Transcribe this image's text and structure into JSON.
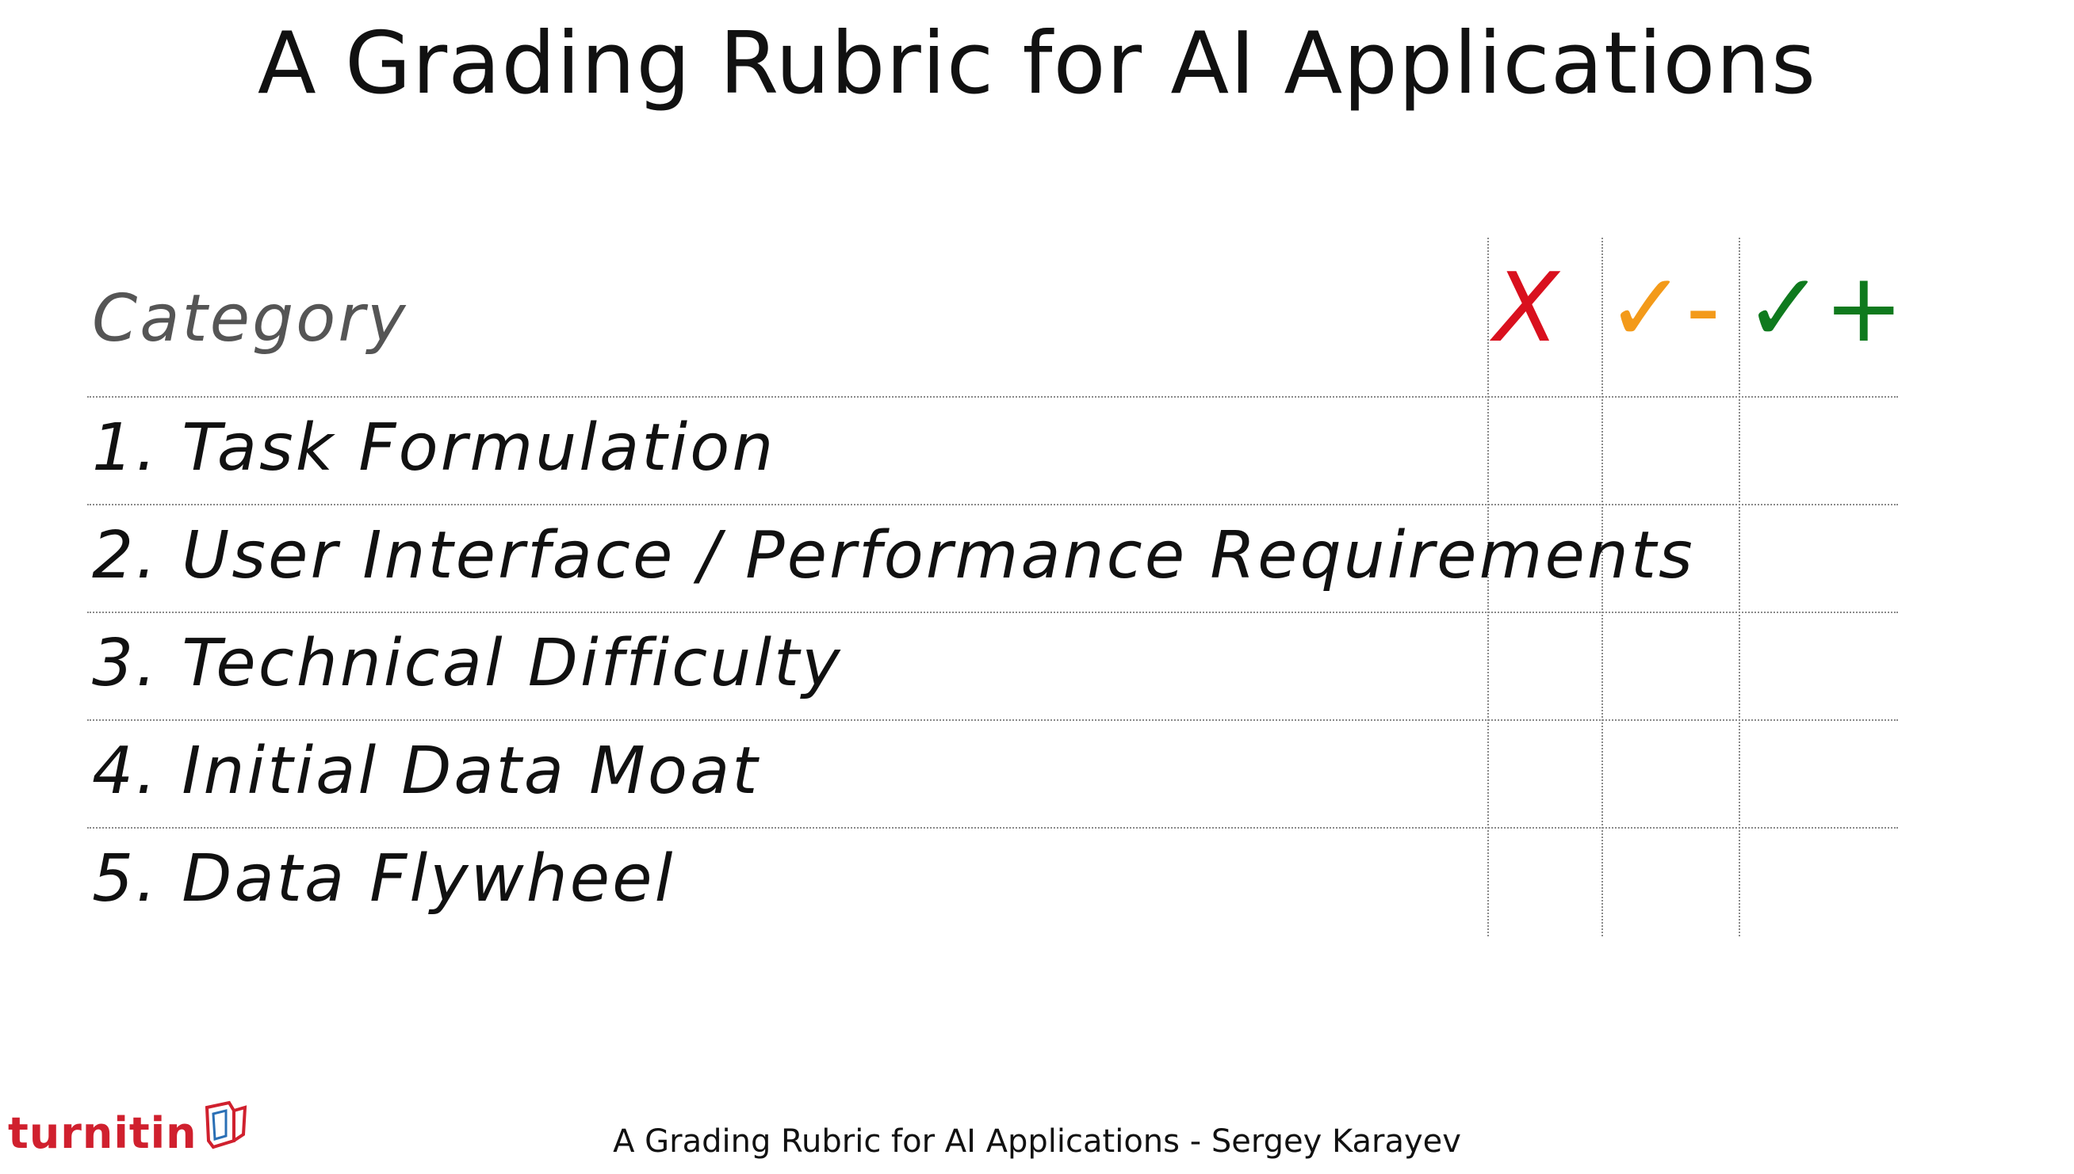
{
  "slide": {
    "title": "A Grading Rubric for AI Applications",
    "footer": "A Grading Rubric for AI Applications - Sergey Karayev"
  },
  "rubric": {
    "category_header": "Category",
    "grades": [
      {
        "symbol": "X",
        "color": "#d9101e",
        "name": "fail"
      },
      {
        "symbol": "✓-",
        "color": "#f39a1a",
        "name": "check-minus"
      },
      {
        "symbol": "✓+",
        "color": "#0f7a1e",
        "name": "check-plus"
      }
    ],
    "rows": [
      "1. Task Formulation",
      "2. User Interface / Performance Requirements",
      "3. Technical Difficulty",
      "4. Initial Data Moat",
      "5. Data Flywheel"
    ]
  },
  "logo": {
    "text": "turnitin",
    "color": "#d0202e",
    "icon": "turnitin-logo-icon"
  }
}
